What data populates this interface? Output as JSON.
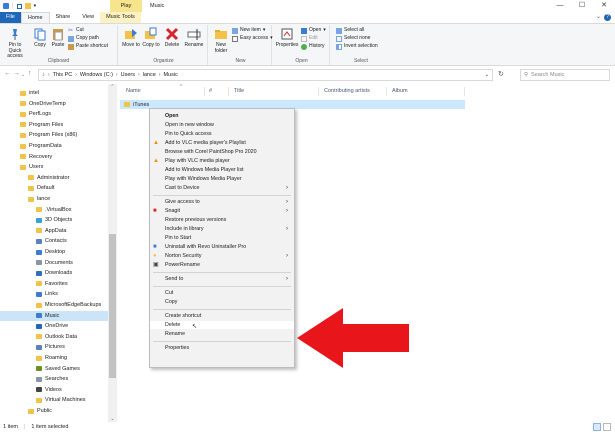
{
  "window": {
    "contextual_tab": "Play",
    "title": "Music",
    "minimize": "—",
    "maximize": "☐",
    "close": "✕"
  },
  "tabs": [
    "File",
    "Home",
    "Share",
    "View",
    "Music Tools"
  ],
  "ribbon": {
    "clipboard": {
      "label": "Clipboard",
      "pin": "Pin to Quick access",
      "copy": "Copy",
      "paste": "Paste",
      "cut": "Cut",
      "copy_path": "Copy path",
      "paste_shortcut": "Paste shortcut"
    },
    "organize": {
      "label": "Organize",
      "move_to": "Move to",
      "copy_to": "Copy to",
      "delete": "Delete",
      "rename": "Rename"
    },
    "new": {
      "label": "New",
      "new_folder": "New folder",
      "new_item": "New item",
      "easy_access": "Easy access"
    },
    "open": {
      "label": "Open",
      "properties": "Properties",
      "open": "Open",
      "edit": "Edit",
      "history": "History"
    },
    "select": {
      "label": "Select",
      "select_all": "Select all",
      "select_none": "Select none",
      "invert": "Invert selection"
    }
  },
  "address": {
    "crumbs": [
      "This PC",
      "Windows (C:)",
      "Users",
      "lance",
      "Music"
    ],
    "search_placeholder": "Search Music"
  },
  "nav_items": [
    {
      "label": "intel",
      "indent": 0
    },
    {
      "label": "OneDriveTemp",
      "indent": 0
    },
    {
      "label": "PerfLogs",
      "indent": 0
    },
    {
      "label": "Program Files",
      "indent": 0
    },
    {
      "label": "Program Files (x86)",
      "indent": 0
    },
    {
      "label": "ProgramData",
      "indent": 0
    },
    {
      "label": "Recovery",
      "indent": 0
    },
    {
      "label": "Users",
      "indent": 0
    },
    {
      "label": "Administrator",
      "indent": 1
    },
    {
      "label": "Default",
      "indent": 1
    },
    {
      "label": "lance",
      "indent": 1
    },
    {
      "label": ".VirtualBox",
      "indent": 2
    },
    {
      "label": "3D Objects",
      "indent": 2
    },
    {
      "label": "AppData",
      "indent": 2
    },
    {
      "label": "Contacts",
      "indent": 2
    },
    {
      "label": "Desktop",
      "indent": 2
    },
    {
      "label": "Documents",
      "indent": 2
    },
    {
      "label": "Downloads",
      "indent": 2
    },
    {
      "label": "Favorites",
      "indent": 2
    },
    {
      "label": "Links",
      "indent": 2
    },
    {
      "label": "MicrosoftEdgeBackups",
      "indent": 2
    },
    {
      "label": "Music",
      "indent": 2,
      "selected": true
    },
    {
      "label": "OneDrive",
      "indent": 2
    },
    {
      "label": "Outlook Data",
      "indent": 2
    },
    {
      "label": "Pictures",
      "indent": 2
    },
    {
      "label": "Roaming",
      "indent": 2
    },
    {
      "label": "Saved Games",
      "indent": 2
    },
    {
      "label": "Searches",
      "indent": 2
    },
    {
      "label": "Videos",
      "indent": 2
    },
    {
      "label": "Virtual Machines",
      "indent": 2
    },
    {
      "label": "Public",
      "indent": 1
    }
  ],
  "columns": [
    "Name",
    "#",
    "Title",
    "Contributing artists",
    "Album"
  ],
  "files": [
    {
      "name": "iTunes"
    }
  ],
  "context_menu": [
    {
      "label": "Open",
      "bold": true
    },
    {
      "label": "Open in new window"
    },
    {
      "label": "Pin to Quick access"
    },
    {
      "label": "Add to VLC media player's Playlist",
      "icon": "vlc"
    },
    {
      "label": "Browse with Corel PaintShop Pro 2020"
    },
    {
      "label": "Play with VLC media player",
      "icon": "vlc"
    },
    {
      "label": "Add to Windows Media Player list"
    },
    {
      "label": "Play with Windows Media Player"
    },
    {
      "label": "Cast to Device",
      "submenu": true
    },
    {
      "sep": true
    },
    {
      "label": "Give access to",
      "submenu": true
    },
    {
      "label": "Snagit",
      "icon": "snagit",
      "submenu": true
    },
    {
      "label": "Restore previous versions"
    },
    {
      "label": "Include in library",
      "submenu": true
    },
    {
      "label": "Pin to Start"
    },
    {
      "label": "Uninstall with Revo Uninstaller Pro",
      "icon": "revo"
    },
    {
      "label": "Norton Security",
      "icon": "norton",
      "submenu": true
    },
    {
      "label": "PowerRename",
      "icon": "powerrename"
    },
    {
      "sep": true
    },
    {
      "label": "Send to",
      "submenu": true
    },
    {
      "sep": true
    },
    {
      "label": "Cut"
    },
    {
      "label": "Copy"
    },
    {
      "sep": true
    },
    {
      "label": "Create shortcut"
    },
    {
      "label": "Delete",
      "hover": true
    },
    {
      "label": "Rename"
    },
    {
      "sep": true
    },
    {
      "label": "Properties"
    }
  ],
  "status": {
    "count": "1 item",
    "selected": "1 item selected"
  },
  "colors": {
    "arrow": "#e8151b",
    "selection": "#cce8ff",
    "accent": "#1f65b8"
  }
}
